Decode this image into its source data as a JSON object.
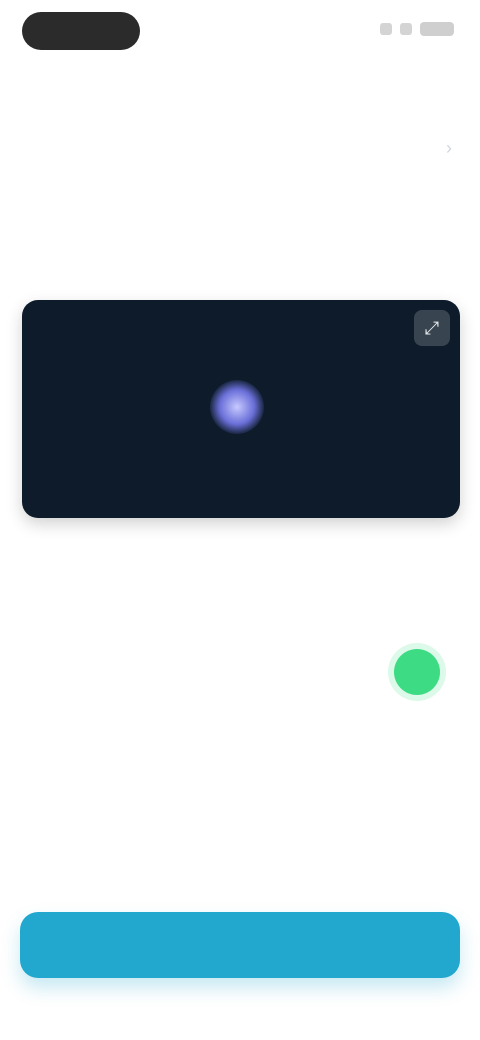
{
  "status_bar": {
    "time": "",
    "battery": ""
  },
  "tabs": [
    {
      "label": "",
      "active": false
    },
    {
      "label": "",
      "active": true
    }
  ],
  "list": {
    "item_label": "",
    "chevron": "›"
  },
  "sections": {
    "video_title": "",
    "toggle_title": "",
    "description_title": ""
  },
  "video": {
    "caption": "",
    "expand_icon": "⤢"
  },
  "toggle_row": {
    "label": "",
    "enabled": true,
    "accent": "#3ddc84"
  },
  "description": {
    "text": ""
  },
  "cta": {
    "label": "",
    "color": "#22a7cf"
  }
}
